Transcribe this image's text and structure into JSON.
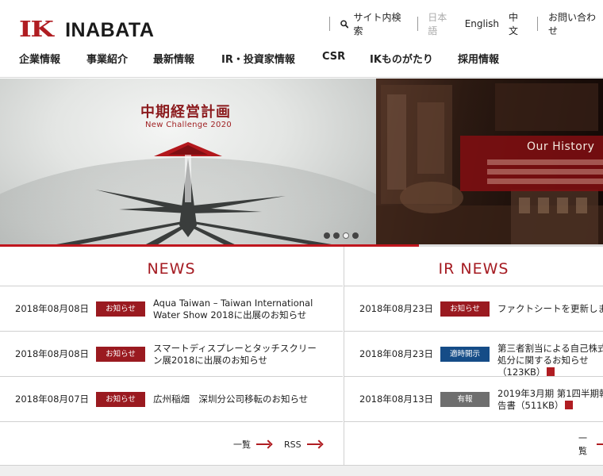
{
  "logo": {
    "mark": "IK",
    "name": "INABATA"
  },
  "utility": {
    "search_label": "サイト内検索",
    "languages": [
      "日本語",
      "English",
      "中文"
    ],
    "contact_label": "お問い合わせ"
  },
  "nav": [
    "企業情報",
    "事業紹介",
    "最新情報",
    "IR・投資家情報",
    "CSR",
    "IKものがたり",
    "採用情報"
  ],
  "hero": {
    "main_title": "中期経営計画",
    "main_subtitle": "New Challenge 2020",
    "side_title": "Our History",
    "slide_count": 4,
    "active_slide": 2
  },
  "news": {
    "heading": "NEWS",
    "items": [
      {
        "date": "2018年08月08日",
        "badge": "お知らせ",
        "title": "Aqua Taiwan – Taiwan International Water Show 2018に出展のお知らせ"
      },
      {
        "date": "2018年08月08日",
        "badge": "お知らせ",
        "title": "スマートディスプレーとタッチスクリーン展2018に出展のお知らせ"
      },
      {
        "date": "2018年08月07日",
        "badge": "お知らせ",
        "title": "広州稲畑　深圳分公司移転のお知らせ"
      }
    ],
    "list_label": "一覧",
    "rss_label": "RSS"
  },
  "ir_news": {
    "heading": "IR NEWS",
    "items": [
      {
        "date": "2018年08月23日",
        "badge": "お知らせ",
        "title": "ファクトシートを更新しま"
      },
      {
        "date": "2018年08月23日",
        "badge": "適時開示",
        "title": "第三者割当による自己株式処分に関するお知らせ（123KB）"
      },
      {
        "date": "2018年08月13日",
        "badge": "有報",
        "title": "2019年3月期 第1四半期報告書（511KB）"
      }
    ],
    "list_label": "一覧"
  },
  "colors": {
    "brand_red": "#b01d22",
    "badge_blue": "#154c87",
    "badge_grey": "#6e6e6e"
  }
}
